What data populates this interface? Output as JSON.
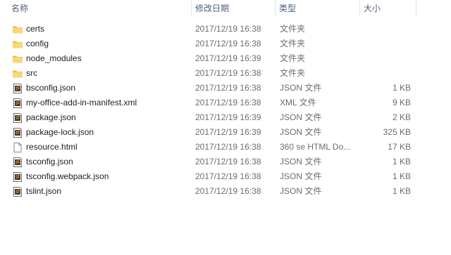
{
  "columns": {
    "name": "名称",
    "date": "修改日期",
    "type": "类型",
    "size": "大小"
  },
  "sort": {
    "column": "name",
    "icon": "chevron-up-icon"
  },
  "colors": {
    "folder": "#F8D775",
    "folder_dark": "#E8B94A",
    "header_text": "#4C607A"
  },
  "files": [
    {
      "name": "certs",
      "date": "2017/12/19 16:38",
      "type": "文件夹",
      "size": "",
      "icon": "folder-icon"
    },
    {
      "name": "config",
      "date": "2017/12/19 16:38",
      "type": "文件夹",
      "size": "",
      "icon": "folder-icon"
    },
    {
      "name": "node_modules",
      "date": "2017/12/19 16:39",
      "type": "文件夹",
      "size": "",
      "icon": "folder-icon"
    },
    {
      "name": "src",
      "date": "2017/12/19 16:38",
      "type": "文件夹",
      "size": "",
      "icon": "folder-icon"
    },
    {
      "name": "bsconfig.json",
      "date": "2017/12/19 16:38",
      "type": "JSON 文件",
      "size": "1 KB",
      "icon": "sublime-file-icon"
    },
    {
      "name": "my-office-add-in-manifest.xml",
      "date": "2017/12/19 16:38",
      "type": "XML 文件",
      "size": "9 KB",
      "icon": "sublime-file-icon"
    },
    {
      "name": "package.json",
      "date": "2017/12/19 16:39",
      "type": "JSON 文件",
      "size": "2 KB",
      "icon": "sublime-file-icon"
    },
    {
      "name": "package-lock.json",
      "date": "2017/12/19 16:39",
      "type": "JSON 文件",
      "size": "325 KB",
      "icon": "sublime-file-icon"
    },
    {
      "name": "resource.html",
      "date": "2017/12/19 16:38",
      "type": "360 se HTML Do...",
      "size": "17 KB",
      "icon": "blank-file-icon"
    },
    {
      "name": "tsconfig.json",
      "date": "2017/12/19 16:38",
      "type": "JSON 文件",
      "size": "1 KB",
      "icon": "sublime-file-icon"
    },
    {
      "name": "tsconfig.webpack.json",
      "date": "2017/12/19 16:38",
      "type": "JSON 文件",
      "size": "1 KB",
      "icon": "sublime-file-icon"
    },
    {
      "name": "tslint.json",
      "date": "2017/12/19 16:38",
      "type": "JSON 文件",
      "size": "1 KB",
      "icon": "sublime-file-icon"
    }
  ]
}
